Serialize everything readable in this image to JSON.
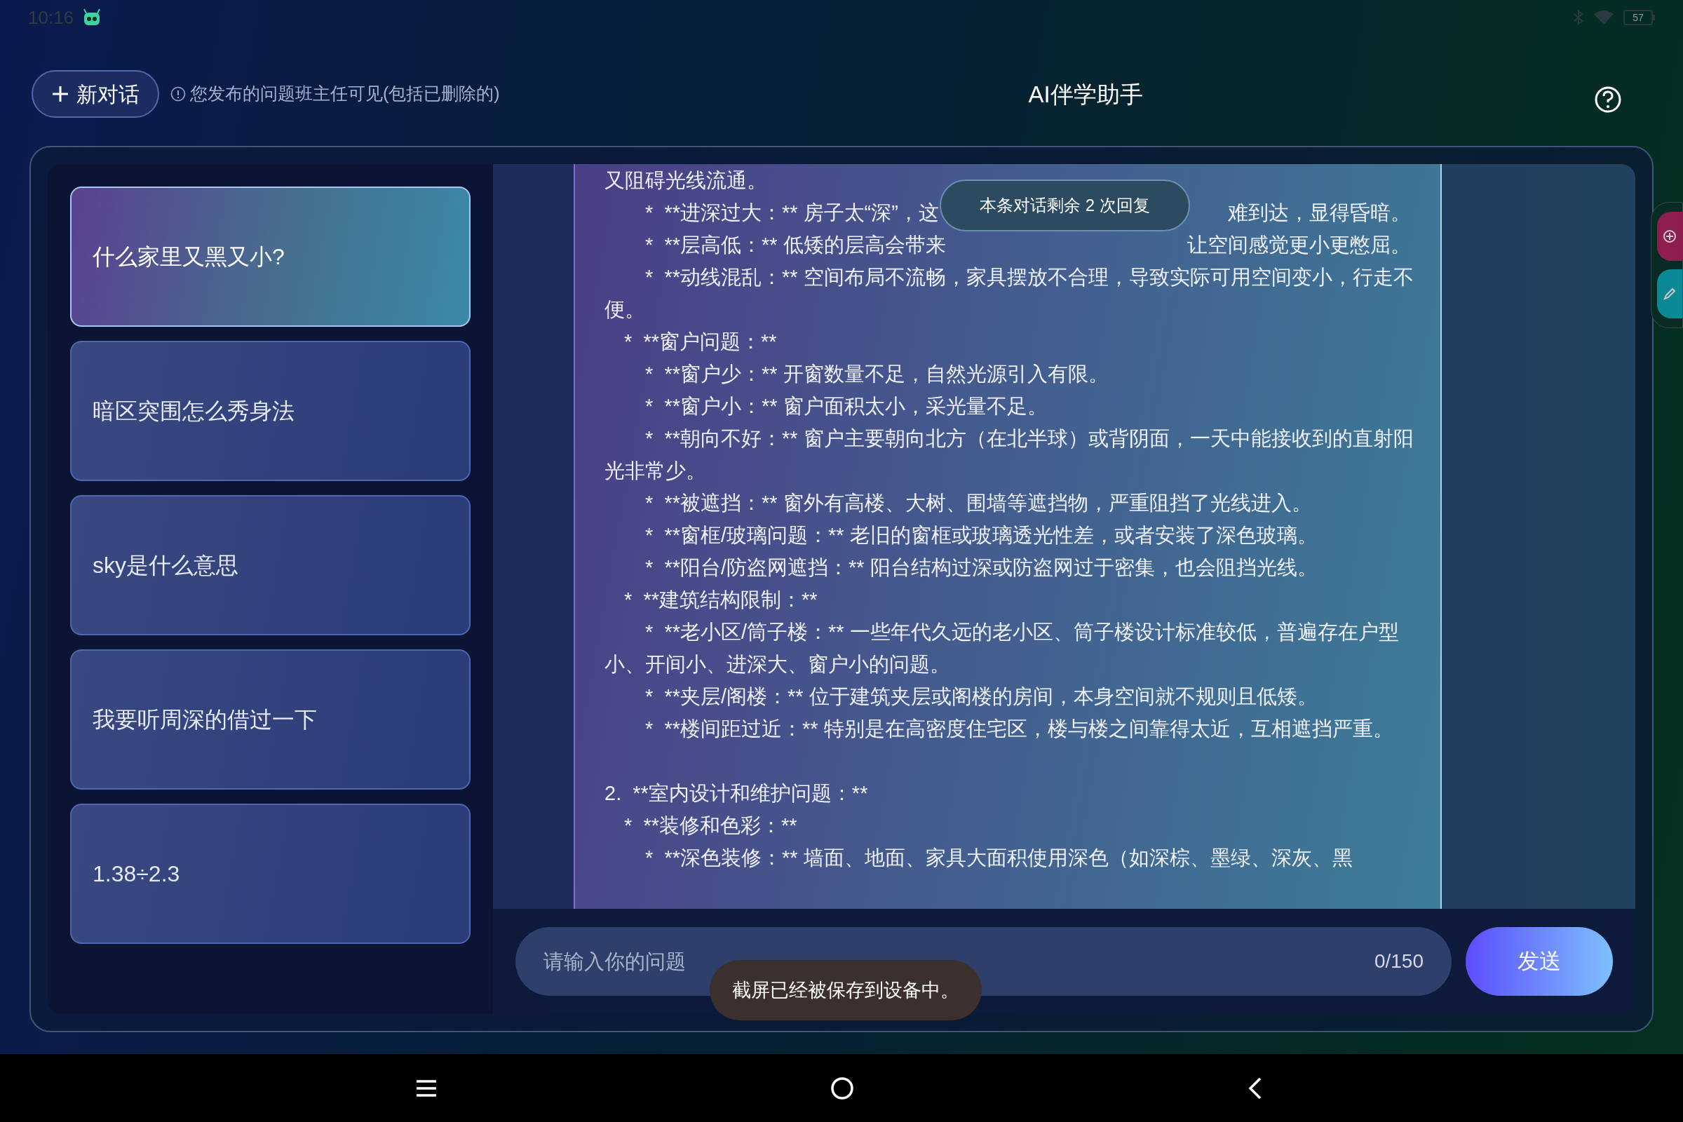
{
  "status_bar": {
    "time": "10:16",
    "battery": "57"
  },
  "header": {
    "new_chat_button": "新对话",
    "notice": "您发布的问题班主任可见(包括已删除的)",
    "title": "AI伴学助手"
  },
  "conversations": [
    {
      "label": "什么家里又黑又小?",
      "selected": true
    },
    {
      "label": "暗区突围怎么秀身法",
      "selected": false
    },
    {
      "label": "sky是什么意思",
      "selected": false
    },
    {
      "label": "我要听周深的借过一下",
      "selected": false
    },
    {
      "label": "1.38÷2.3",
      "selected": false
    }
  ],
  "reply_notice": "本条对话剩余 2 次回复",
  "message_lines": [
    {
      "kind": "text",
      "text": "又阻碍光线流通。"
    },
    {
      "kind": "sub_covered",
      "before": "*  **进深过大：** 房子太“深”，这",
      "after": "难到达，显得昏暗。"
    },
    {
      "kind": "sub_covered",
      "before": "*  **层高低：** 低矮的层高会带来",
      "after": "让空间感觉更小更憋屈。"
    },
    {
      "kind": "sub",
      "text": "*  **动线混乱：** 空间布局不流畅，家具摆放不合理，导致实际可用空间变小，行走不便。"
    },
    {
      "kind": "bullet",
      "text": "*  **窗户问题：**"
    },
    {
      "kind": "sub",
      "text": "*  **窗户少：** 开窗数量不足，自然光源引入有限。"
    },
    {
      "kind": "sub",
      "text": "*  **窗户小：** 窗户面积太小，采光量不足。"
    },
    {
      "kind": "sub",
      "text": "*  **朝向不好：** 窗户主要朝向北方（在北半球）或背阴面，一天中能接收到的直射阳光非常少。"
    },
    {
      "kind": "sub",
      "text": "*  **被遮挡：** 窗外有高楼、大树、围墙等遮挡物，严重阻挡了光线进入。"
    },
    {
      "kind": "sub",
      "text": "*  **窗框/玻璃问题：** 老旧的窗框或玻璃透光性差，或者安装了深色玻璃。"
    },
    {
      "kind": "sub",
      "text": "*  **阳台/防盗网遮挡：** 阳台结构过深或防盗网过于密集，也会阻挡光线。"
    },
    {
      "kind": "bullet",
      "text": "*  **建筑结构限制：**"
    },
    {
      "kind": "sub",
      "text": "*  **老小区/筒子楼：** 一些年代久远的老小区、筒子楼设计标准较低，普遍存在户型小、开间小、进深大、窗户小的问题。"
    },
    {
      "kind": "sub",
      "text": "*  **夹层/阁楼：** 位于建筑夹层或阁楼的房间，本身空间就不规则且低矮。"
    },
    {
      "kind": "sub",
      "text": "*  **楼间距过近：** 特别是在高密度住宅区，楼与楼之间靠得太近，互相遮挡严重。"
    },
    {
      "kind": "numbered",
      "text": "2.  **室内设计和维护问题：**"
    },
    {
      "kind": "bullet",
      "text": "*  **装修和色彩：**"
    },
    {
      "kind": "sub",
      "text": "*  **深色装修：** 墙面、地面、家具大面积使用深色（如深棕、墨绿、深灰、黑"
    }
  ],
  "input": {
    "placeholder": "请输入你的问题",
    "counter": "0/150"
  },
  "send_button": "发送",
  "toast": "截屏已经被保存到设备中。"
}
